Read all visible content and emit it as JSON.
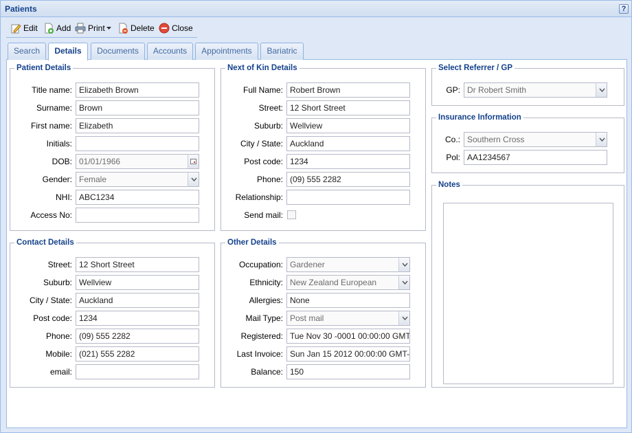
{
  "window": {
    "title": "Patients",
    "help_label": "?"
  },
  "toolbar": {
    "edit": "Edit",
    "add": "Add",
    "print": "Print",
    "delete": "Delete",
    "close": "Close"
  },
  "tabs": [
    "Search",
    "Details",
    "Documents",
    "Accounts",
    "Appointments",
    "Bariatric"
  ],
  "active_tab": "Details",
  "patient_details": {
    "legend": "Patient Details",
    "title_name": {
      "label": "Title name:",
      "value": "Elizabeth Brown"
    },
    "surname": {
      "label": "Surname:",
      "value": "Brown"
    },
    "first_name": {
      "label": "First name:",
      "value": "Elizabeth"
    },
    "initials": {
      "label": "Initials:",
      "value": ""
    },
    "dob": {
      "label": "DOB:",
      "value": "01/01/1966"
    },
    "gender": {
      "label": "Gender:",
      "value": "Female"
    },
    "nhi": {
      "label": "NHI:",
      "value": "ABC1234"
    },
    "access_no": {
      "label": "Access No:",
      "value": ""
    }
  },
  "contact_details": {
    "legend": "Contact Details",
    "street": {
      "label": "Street:",
      "value": "12 Short Street"
    },
    "suburb": {
      "label": "Suburb:",
      "value": "Wellview"
    },
    "city_state": {
      "label": "City / State:",
      "value": "Auckland"
    },
    "post_code": {
      "label": "Post code:",
      "value": "1234"
    },
    "phone": {
      "label": "Phone:",
      "value": "(09) 555 2282"
    },
    "mobile": {
      "label": "Mobile:",
      "value": "(021) 555 2282"
    },
    "email": {
      "label": "email:",
      "value": ""
    }
  },
  "next_of_kin": {
    "legend": "Next of Kin Details",
    "full_name": {
      "label": "Full Name:",
      "value": "Robert Brown"
    },
    "street": {
      "label": "Street:",
      "value": "12 Short Street"
    },
    "suburb": {
      "label": "Suburb:",
      "value": "Wellview"
    },
    "city_state": {
      "label": "City / State:",
      "value": "Auckland"
    },
    "post_code": {
      "label": "Post code:",
      "value": "1234"
    },
    "phone": {
      "label": "Phone:",
      "value": "(09) 555 2282"
    },
    "relationship": {
      "label": "Relationship:",
      "value": ""
    },
    "send_mail": {
      "label": "Send mail:",
      "checked": false
    }
  },
  "other_details": {
    "legend": "Other Details",
    "occupation": {
      "label": "Occupation:",
      "value": "Gardener"
    },
    "ethnicity": {
      "label": "Ethnicity:",
      "value": "New Zealand European"
    },
    "allergies": {
      "label": "Allergies:",
      "value": "None"
    },
    "mail_type": {
      "label": "Mail Type:",
      "value": "Post mail"
    },
    "registered": {
      "label": "Registered:",
      "value": "Tue Nov 30 -0001 00:00:00 GMT"
    },
    "last_invoice": {
      "label": "Last Invoice:",
      "value": "Sun Jan 15 2012 00:00:00 GMT-"
    },
    "balance": {
      "label": "Balance:",
      "value": "150"
    }
  },
  "referrer": {
    "legend": "Select Referrer / GP",
    "gp": {
      "label": "GP:",
      "value": "Dr Robert Smith"
    }
  },
  "insurance": {
    "legend": "Insurance Information",
    "company": {
      "label": "Co.:",
      "value": "Southern Cross"
    },
    "policy": {
      "label": "Pol:",
      "value": "AA1234567"
    }
  },
  "notes": {
    "legend": "Notes",
    "value": ""
  },
  "colors": {
    "accent": "#15428b",
    "panel_bg": "#dfe8f6",
    "border": "#99bbe8"
  },
  "icons": {
    "edit": "pencil-icon",
    "add": "add-page-icon",
    "print": "printer-icon",
    "delete": "delete-page-icon",
    "close": "close-circle-icon",
    "date_trigger": "calendar-icon",
    "combo_trigger": "chevron-down-icon"
  }
}
